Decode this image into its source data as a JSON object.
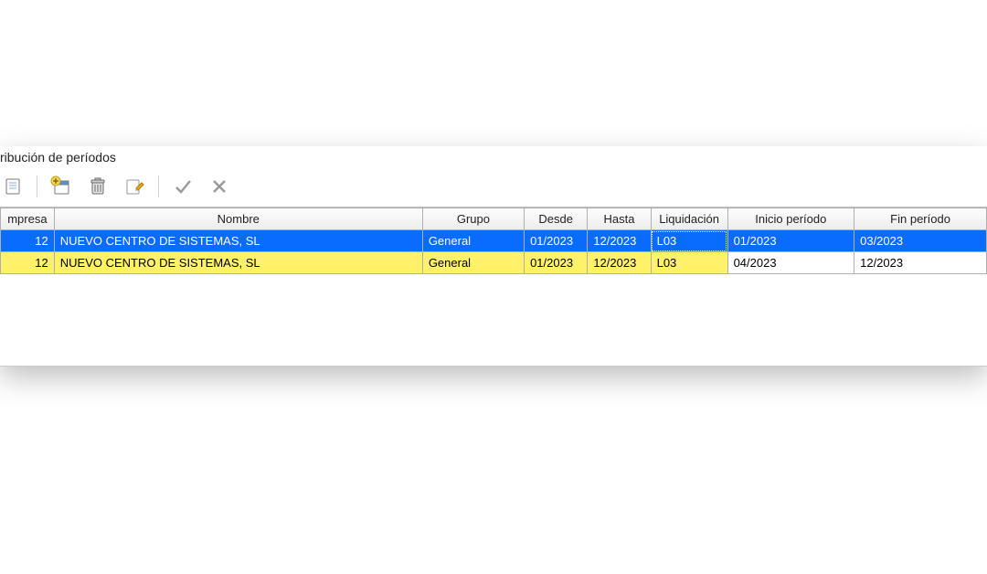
{
  "title": "ribución de períodos",
  "toolbar": {
    "icons": {
      "generic": "generic-icon",
      "add": "add-icon",
      "delete": "delete-icon",
      "edit": "edit-icon",
      "confirm": "check-icon",
      "cancel": "x-icon"
    }
  },
  "table": {
    "headers": {
      "empresa": "mpresa",
      "nombre": "Nombre",
      "grupo": "Grupo",
      "desde": "Desde",
      "hasta": "Hasta",
      "liquidacion": "Liquidación",
      "inicio_periodo": "Inicio período",
      "fin_periodo": "Fin período"
    },
    "rows": [
      {
        "empresa": "12",
        "nombre": "NUEVO CENTRO DE SISTEMAS, SL",
        "grupo": "General",
        "desde": "01/2023",
        "hasta": "12/2023",
        "liquidacion": "L03",
        "inicio_periodo": "01/2023",
        "fin_periodo": "03/2023",
        "selected": true
      },
      {
        "empresa": "12",
        "nombre": "NUEVO CENTRO DE SISTEMAS, SL",
        "grupo": "General",
        "desde": "01/2023",
        "hasta": "12/2023",
        "liquidacion": "L03",
        "inicio_periodo": "04/2023",
        "fin_periodo": "12/2023",
        "selected": false
      }
    ]
  }
}
